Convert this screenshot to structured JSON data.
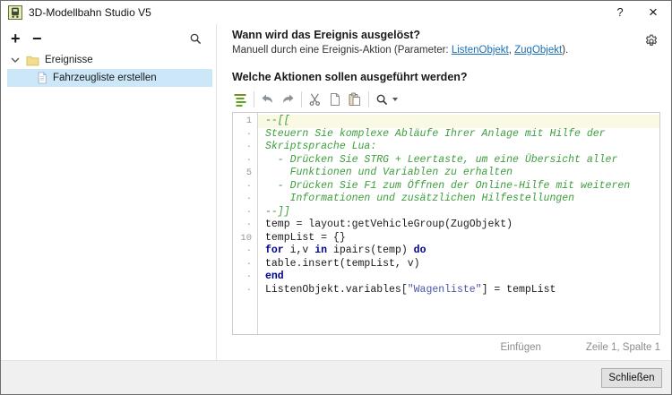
{
  "window": {
    "title": "3D-Modellbahn Studio V5",
    "help_label": "?",
    "close_label": "×"
  },
  "sidebar": {
    "add_label": "+",
    "remove_label": "−",
    "tree": {
      "folder_label": "Ereignisse",
      "selected_item_label": "Fahrzeugliste erstellen"
    }
  },
  "trigger_section": {
    "heading": "Wann wird das Ereignis ausgelöst?",
    "description_prefix": "Manuell durch eine Ereignis-Aktion (Parameter: ",
    "link1": "ListenObjekt",
    "link_separator": ", ",
    "link2": "ZugObjekt",
    "description_suffix": ")."
  },
  "actions_section": {
    "heading": "Welche Aktionen sollen ausgeführt werden?",
    "toolbar_icons": [
      "format-code",
      "undo",
      "redo",
      "cut",
      "copy",
      "paste",
      "search"
    ]
  },
  "editor": {
    "lines": [
      {
        "gutter": "1",
        "current": true,
        "segments": [
          {
            "text": "--[[",
            "style": "comment"
          }
        ]
      },
      {
        "gutter": "·",
        "segments": [
          {
            "text": "Steuern Sie komplexe Abläufe Ihrer Anlage mit Hilfe der",
            "style": "comment"
          }
        ]
      },
      {
        "gutter": "·",
        "segments": [
          {
            "text": "Skriptsprache Lua:",
            "style": "comment"
          }
        ]
      },
      {
        "gutter": "·",
        "segments": [
          {
            "text": "  - Drücken Sie STRG + Leertaste, um eine Übersicht aller",
            "style": "comment"
          }
        ]
      },
      {
        "gutter": "5",
        "segments": [
          {
            "text": "    Funktionen und Variablen zu erhalten",
            "style": "comment"
          }
        ]
      },
      {
        "gutter": "·",
        "segments": [
          {
            "text": "  - Drücken Sie F1 zum Öffnen der Online-Hilfe mit weiteren",
            "style": "comment"
          }
        ]
      },
      {
        "gutter": "·",
        "segments": [
          {
            "text": "    Informationen und zusätzlichen Hilfestellungen",
            "style": "comment"
          }
        ]
      },
      {
        "gutter": "·",
        "segments": [
          {
            "text": "--]]",
            "style": "comment"
          }
        ]
      },
      {
        "gutter": "·",
        "segments": [
          {
            "text": "temp = layout:getVehicleGroup(ZugObjekt)",
            "style": "plain"
          }
        ]
      },
      {
        "gutter": "10",
        "segments": [
          {
            "text": "tempList = {}",
            "style": "plain"
          }
        ]
      },
      {
        "gutter": "·",
        "segments": [
          {
            "text": "for",
            "style": "keyword"
          },
          {
            "text": " i,v ",
            "style": "plain"
          },
          {
            "text": "in",
            "style": "keyword"
          },
          {
            "text": " ipairs(temp) ",
            "style": "plain"
          },
          {
            "text": "do",
            "style": "keyword"
          }
        ]
      },
      {
        "gutter": "·",
        "segments": [
          {
            "text": "table.insert(tempList, v)",
            "style": "plain"
          }
        ]
      },
      {
        "gutter": "·",
        "segments": [
          {
            "text": "end",
            "style": "keyword"
          }
        ]
      },
      {
        "gutter": "·",
        "segments": [
          {
            "text": "ListenObjekt.variables[",
            "style": "plain"
          },
          {
            "text": "\"Wagenliste\"",
            "style": "string"
          },
          {
            "text": "] = tempList",
            "style": "plain"
          }
        ]
      }
    ],
    "status_mode": "Einfügen",
    "status_position": "Zeile 1, Spalte 1"
  },
  "footer": {
    "close_button": "Schließen"
  },
  "colors": {
    "selection_bg": "#cbe7f8",
    "link": "#1a70b8",
    "comment": "#3d9e3d",
    "keyword": "#00008b",
    "string": "#4a56a6",
    "current_line_bg": "#fafae4",
    "footer_bg": "#f0f0f0"
  }
}
